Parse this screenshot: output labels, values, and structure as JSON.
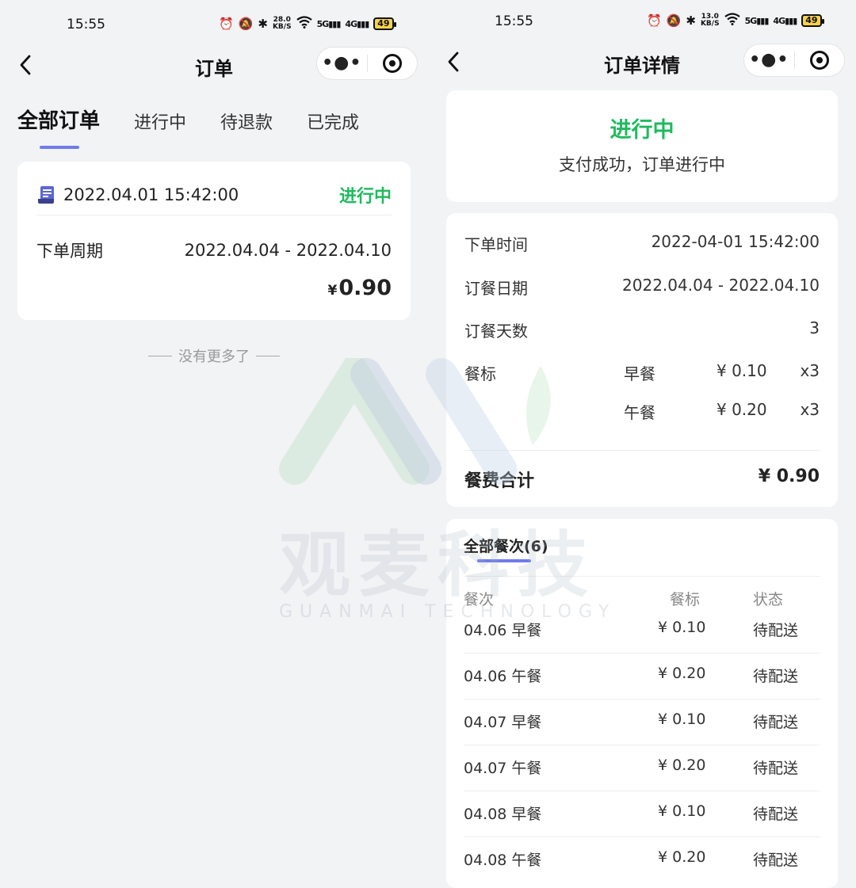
{
  "left": {
    "status_bar": {
      "time": "15:55",
      "speed_top": "28.0",
      "speed_bottom": "KB/S",
      "sig1": "5G",
      "sig2": "4G",
      "battery": "49"
    },
    "nav": {
      "title": "订单"
    },
    "tabs": [
      {
        "label": "全部订单",
        "active": true
      },
      {
        "label": "进行中"
      },
      {
        "label": "待退款"
      },
      {
        "label": "已完成"
      }
    ],
    "order": {
      "time": "2022.04.01 15:42:00",
      "status": "进行中",
      "period_label": "下单周期",
      "period_value": "2022.04.04 - 2022.04.10",
      "currency": "¥",
      "amount": "0.90"
    },
    "no_more": "没有更多了"
  },
  "right": {
    "status_bar": {
      "time": "15:55",
      "speed_top": "13.0",
      "speed_bottom": "KB/S",
      "sig1": "5G",
      "sig2": "4G",
      "battery": "49"
    },
    "nav": {
      "title": "订单详情"
    },
    "status_card": {
      "status": "进行中",
      "subtitle": "支付成功，订单进行中"
    },
    "details": {
      "order_time_label": "下单时间",
      "order_time_value": "2022-04-01 15:42:00",
      "date_label": "订餐日期",
      "date_value": "2022.04.04 - 2022.04.10",
      "days_label": "订餐天数",
      "days_value": "3",
      "meal_label": "餐标",
      "meals": [
        {
          "name": "早餐",
          "price": "¥ 0.10",
          "qty": "x3"
        },
        {
          "name": "午餐",
          "price": "¥ 0.20",
          "qty": "x3"
        }
      ],
      "total_label": "餐费合计",
      "total_value": "¥ 0.90"
    },
    "meals_list": {
      "tab_label": "全部餐次(6)",
      "headers": {
        "meal": "餐次",
        "price": "餐标",
        "status": "状态"
      },
      "rows": [
        {
          "meal": "04.06 早餐",
          "price": "¥ 0.10",
          "status": "待配送"
        },
        {
          "meal": "04.06 午餐",
          "price": "¥ 0.20",
          "status": "待配送"
        },
        {
          "meal": "04.07 早餐",
          "price": "¥ 0.10",
          "status": "待配送"
        },
        {
          "meal": "04.07 午餐",
          "price": "¥ 0.20",
          "status": "待配送"
        },
        {
          "meal": "04.08 早餐",
          "price": "¥ 0.10",
          "status": "待配送"
        },
        {
          "meal": "04.08 午餐",
          "price": "¥ 0.20",
          "status": "待配送"
        }
      ]
    }
  },
  "watermark": {
    "main": "观麦科技",
    "sub": "GUANMAI TECHNOLOGY"
  },
  "colors": {
    "accent_green": "#1fba5e",
    "tab_indicator": "#6f7bea",
    "background": "#f2f3f5"
  },
  "icons": [
    "alarm-icon",
    "mute-icon",
    "bluetooth-icon",
    "wifi-icon",
    "back-arrow-icon",
    "more-dots-icon",
    "target-icon",
    "ticket-icon"
  ]
}
